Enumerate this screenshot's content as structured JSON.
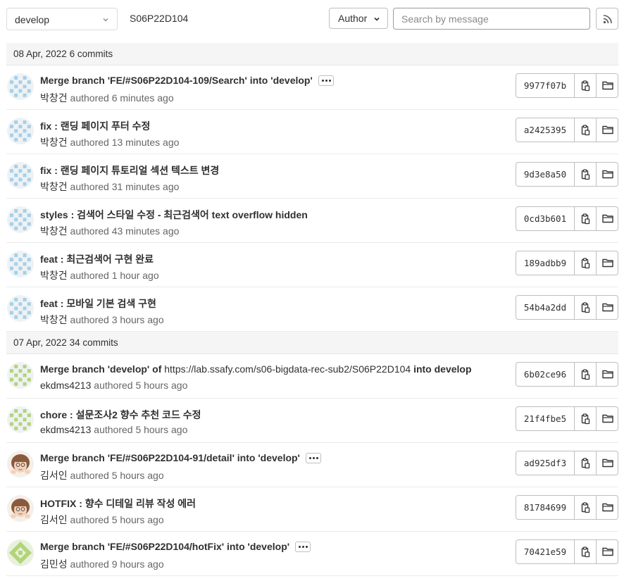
{
  "toolbar": {
    "branch": "develop",
    "path": "S06P22D104",
    "author_label": "Author",
    "search_placeholder": "Search by message"
  },
  "icons": {
    "chevron": "chevron-down-icon",
    "rss": "rss-icon",
    "copy": "copy-icon",
    "folder": "folder-icon"
  },
  "colors": {
    "identicon_blue": "#a7d0e8",
    "identicon_green": "#b3d47a"
  },
  "days": [
    {
      "header": "08 Apr, 2022 6 commits",
      "commits": [
        {
          "title_bold": "Merge branch 'FE/#S06P22D104-109/Search' into 'develop'",
          "title_plain": "",
          "title_tail": "",
          "has_ellipsis": true,
          "author": "박창건",
          "time": "authored 6 minutes ago",
          "sha": "9977f07b",
          "avatar": "identicon-blue"
        },
        {
          "title_bold": "fix : 랜딩 페이지 푸터 수정",
          "title_plain": "",
          "title_tail": "",
          "has_ellipsis": false,
          "author": "박창건",
          "time": "authored 13 minutes ago",
          "sha": "a2425395",
          "avatar": "identicon-blue"
        },
        {
          "title_bold": "fix : 랜딩 페이지 튜토리얼 섹션 텍스트 변경",
          "title_plain": "",
          "title_tail": "",
          "has_ellipsis": false,
          "author": "박창건",
          "time": "authored 31 minutes ago",
          "sha": "9d3e8a50",
          "avatar": "identicon-blue"
        },
        {
          "title_bold": "styles : 검색어 스타일 수정 - 최근검색어 text overflow hidden",
          "title_plain": "",
          "title_tail": "",
          "has_ellipsis": false,
          "author": "박창건",
          "time": "authored 43 minutes ago",
          "sha": "0cd3b601",
          "avatar": "identicon-blue"
        },
        {
          "title_bold": "feat : 최근검색어 구현 완료",
          "title_plain": "",
          "title_tail": "",
          "has_ellipsis": false,
          "author": "박창건",
          "time": "authored 1 hour ago",
          "sha": "189adbb9",
          "avatar": "identicon-blue"
        },
        {
          "title_bold": "feat : 모바일 기본 검색 구현",
          "title_plain": "",
          "title_tail": "",
          "has_ellipsis": false,
          "author": "박창건",
          "time": "authored 3 hours ago",
          "sha": "54b4a2dd",
          "avatar": "identicon-blue"
        }
      ]
    },
    {
      "header": "07 Apr, 2022 34 commits",
      "commits": [
        {
          "title_bold": "Merge branch 'develop' of ",
          "title_plain": "https://lab.ssafy.com/s06-bigdata-rec-sub2/S06P22D104",
          "title_tail": " into develop",
          "has_ellipsis": false,
          "author": "ekdms4213",
          "time": "authored 5 hours ago",
          "sha": "6b02ce96",
          "avatar": "identicon-green"
        },
        {
          "title_bold": "chore : 설문조사2 향수 추천 코드 수정",
          "title_plain": "",
          "title_tail": "",
          "has_ellipsis": false,
          "author": "ekdms4213",
          "time": "authored 5 hours ago",
          "sha": "21f4fbe5",
          "avatar": "identicon-green"
        },
        {
          "title_bold": "Merge branch 'FE/#S06P22D104-91/detail' into 'develop'",
          "title_plain": "",
          "title_tail": "",
          "has_ellipsis": true,
          "author": "김서인",
          "time": "authored 5 hours ago",
          "sha": "ad925df3",
          "avatar": "photo"
        },
        {
          "title_bold": "HOTFIX : 향수 디테일 리뷰 작성 에러",
          "title_plain": "",
          "title_tail": "",
          "has_ellipsis": false,
          "author": "김서인",
          "time": "authored 5 hours ago",
          "sha": "81784699",
          "avatar": "photo"
        },
        {
          "title_bold": "Merge branch 'FE/#S06P22D104/hotFix' into 'develop'",
          "title_plain": "",
          "title_tail": "",
          "has_ellipsis": true,
          "author": "김민성",
          "time": "authored 9 hours ago",
          "sha": "70421e59",
          "avatar": "identicon-green-diamond"
        }
      ]
    }
  ]
}
